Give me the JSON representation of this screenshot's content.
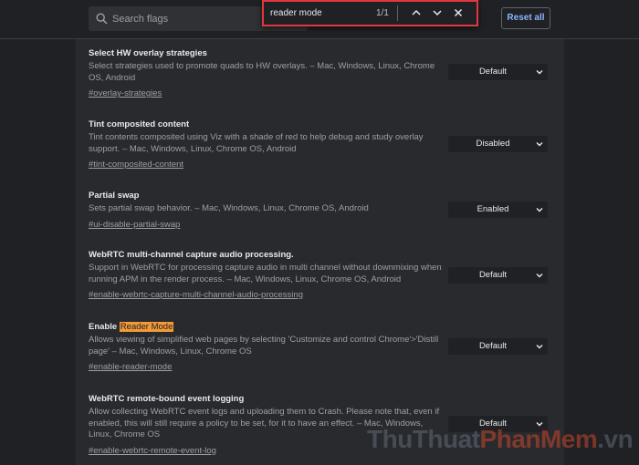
{
  "search": {
    "placeholder": "Search flags"
  },
  "find_bar": {
    "query": "reader mode",
    "count": "1/1"
  },
  "toolbar": {
    "reset_label": "Reset all"
  },
  "flags": [
    {
      "title": "Select HW overlay strategies",
      "description": "Select strategies used to promote quads to HW overlays. – Mac, Windows, Linux, Chrome OS, Android",
      "link": "#overlay-strategies",
      "value": "Default"
    },
    {
      "title": "Tint composited content",
      "description": "Tint contents composited using Viz with a shade of red to help debug and study overlay support. – Mac, Windows, Linux, Chrome OS, Android",
      "link": "#tint-composited-content",
      "value": "Disabled"
    },
    {
      "title": "Partial swap",
      "description": "Sets partial swap behavior. – Mac, Windows, Linux, Chrome OS, Android",
      "link": "#ui-disable-partial-swap",
      "value": "Enabled"
    },
    {
      "title": "WebRTC multi-channel capture audio processing.",
      "description": "Support in WebRTC for processing capture audio in multi channel without downmixing when running APM in the render process. – Mac, Windows, Linux, Chrome OS, Android",
      "link": "#enable-webrtc-capture-multi-channel-audio-processing",
      "value": "Default"
    },
    {
      "title_prefix": "Enable ",
      "title_highlight": "Reader Mode",
      "description": "Allows viewing of simplified web pages by selecting 'Customize and control Chrome'>'Distill page' – Mac, Windows, Linux, Chrome OS",
      "link": "#enable-reader-mode",
      "value": "Default"
    },
    {
      "title": "WebRTC remote-bound event logging",
      "description": "Allow collecting WebRTC event logs and uploading them to Crash. Please note that, even if enabled, this will still require a policy to be set, for it to have an effect. – Mac, Windows, Linux, Chrome OS",
      "link": "#enable-webrtc-remote-event-log",
      "value": "Default"
    }
  ],
  "watermark": {
    "part1": "ThuThuat",
    "part2": "PhanMem",
    "part3": ".vn"
  },
  "colors": {
    "background": "#202124",
    "panel": "#292a2d",
    "accent": "#8ab4f8",
    "highlight": "#f29a38",
    "find_border": "#e0383e"
  }
}
